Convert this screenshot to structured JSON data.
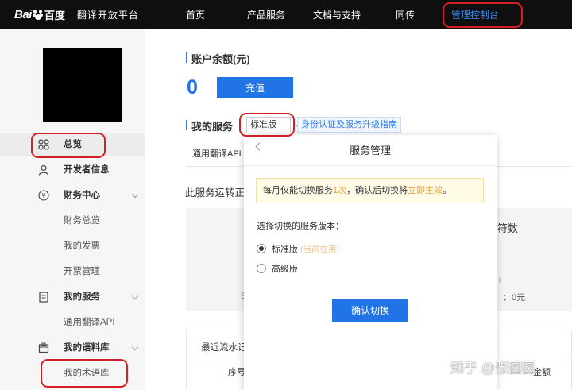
{
  "topbar": {
    "logo_bai": "Bai",
    "logo_du": "百度",
    "logo_sub": "翻译开放平台",
    "nav": [
      {
        "label": "首页"
      },
      {
        "label": "产品服务"
      },
      {
        "label": "文档与支持"
      },
      {
        "label": "同传"
      },
      {
        "label": "管理控制台"
      }
    ],
    "console_color": "#3b8df0"
  },
  "sidebar": {
    "items": [
      {
        "label": "总览",
        "icon": "grid-icon"
      },
      {
        "label": "开发者信息",
        "icon": "user-icon"
      },
      {
        "label": "财务中心",
        "icon": "yen-icon"
      },
      {
        "label": "财务总览"
      },
      {
        "label": "我的发票"
      },
      {
        "label": "开票管理"
      },
      {
        "label": "我的服务",
        "icon": "document-icon"
      },
      {
        "label": "通用翻译API"
      },
      {
        "label": "我的语料库",
        "icon": "box-icon"
      },
      {
        "label": "我的术语库"
      }
    ]
  },
  "main": {
    "balance_title": "账户余额(元)",
    "balance_value": "0",
    "recharge_label": "充值",
    "service_title": "我的服务",
    "version_selected": "标准版",
    "guide_link": "身份认证及服务升级指南",
    "tab_api": "通用翻译API",
    "status_text": "此服务运转正",
    "stat_label": "符数",
    "stat_value": "：0元",
    "stat_e": "E",
    "flow_title": "最近流水记",
    "flow_col_1": "序号",
    "flow_col_2": "金额"
  },
  "modal": {
    "title": "服务管理",
    "notice_pre": "每月仅能切换服务",
    "notice_hl1": "1次",
    "notice_mid": "，确认后切换将",
    "notice_hl2": "立即生效",
    "notice_end": "。",
    "choose_label": "选择切换的服务版本：",
    "options": [
      {
        "label": "标准版",
        "tag": "(当前在用)",
        "selected": true
      },
      {
        "label": "高级版",
        "tag": "",
        "selected": false
      }
    ],
    "confirm_label": "确认切换"
  },
  "watermark": "知乎 @张圆圆",
  "colors": {
    "accent": "#2174e6",
    "annotation_red": "#d41f26",
    "notice_bg": "#fffbe6"
  }
}
